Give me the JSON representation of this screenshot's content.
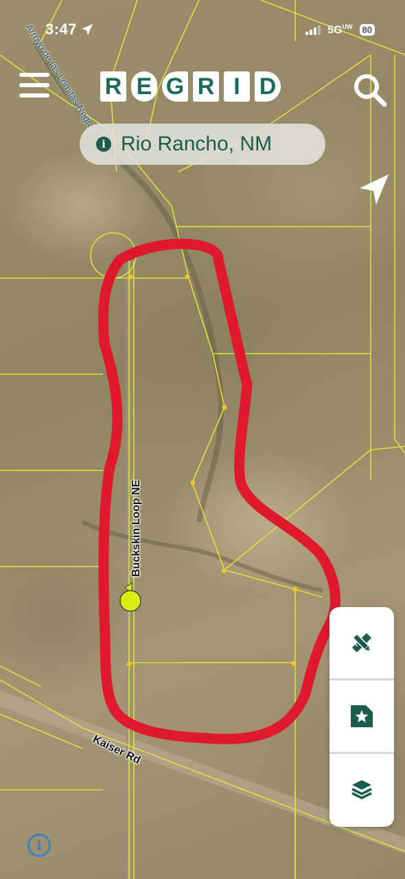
{
  "status_bar": {
    "time": "3:47",
    "network": "5G",
    "network_suffix": "UW",
    "battery": "80"
  },
  "header": {
    "logo_letters": [
      "R",
      "E",
      "G",
      "R",
      "I",
      "D"
    ]
  },
  "location": {
    "text": "Rio Rancho, NM"
  },
  "map": {
    "labels": {
      "arroyo": "Arroyo de las Lomitas Negras",
      "buckskin": "Buckskin Loop NE",
      "kaiser": "Kaiser Rd"
    },
    "colors": {
      "parcel_lines": "#d8e43a",
      "annotation": "#e0192e",
      "marker": "#d7ef10"
    }
  },
  "toolbar": {
    "tools": [
      "pencil-ruler-icon",
      "bookmark-star-icon",
      "layers-icon"
    ]
  },
  "colors": {
    "brand": "#1c6b5a"
  }
}
